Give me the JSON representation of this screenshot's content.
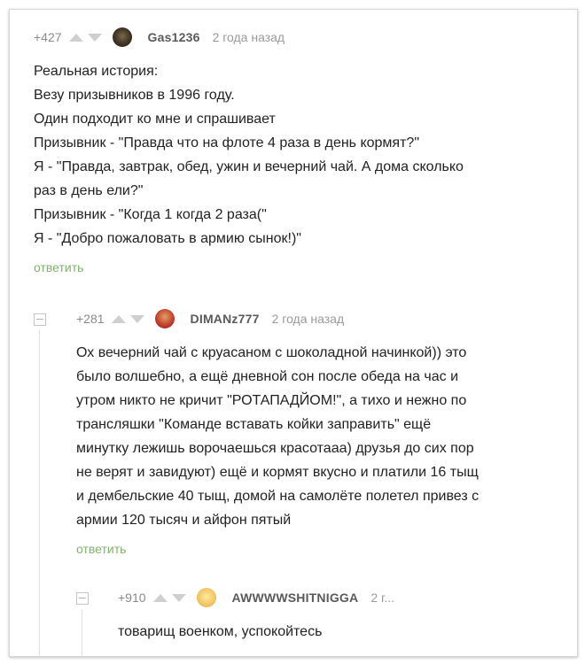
{
  "comments": [
    {
      "rating": "+427",
      "nick": "Gas1236",
      "time": "2 года назад",
      "lines": [
        "Реальная история:",
        "Везу призывников в 1996 году.",
        "Один подходит ко мне и спрашивает",
        "Призывник - \"Правда что на флоте 4 раза в день кормят?\"",
        "Я - \"Правда, завтрак, обед, ужин и вечерний чай. А дома сколько",
        "раз в день ели?\"",
        "Призывник - \"Когда 1 когда 2 раза(\"",
        "Я - \"Добро пожаловать в армию сынок!)\""
      ],
      "reply": "ответить"
    },
    {
      "rating": "+281",
      "nick": "DIMANz777",
      "time": "2 года назад",
      "lines": [
        "Ох вечерний чай с круасаном с шоколадной начинкой)) это",
        "было волшебно, а ещё дневной сон после обеда на час и",
        "утром никто не кричит \"РОТАПАДЙОМ!\", а тихо и нежно по",
        "трансляшки \"Команде вставать койки заправить\" ещё",
        "минутку лежишь ворочаешься красотааа) друзья до сих пор",
        "не верят и завидуют) ещё и кормят вкусно и платили 16 тыщ",
        "и дембельские 40 тыщ, домой на самолёте полетел привез с",
        "армии 120 тысяч и айфон пятый"
      ],
      "reply": "ответить"
    },
    {
      "rating": "+910",
      "nick": "AWWWWSHITNIGGA",
      "time": "2 г...",
      "lines": [
        "товарищ военком, успокойтесь"
      ]
    }
  ]
}
